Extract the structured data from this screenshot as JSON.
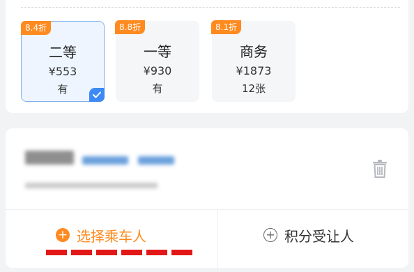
{
  "seat_options": [
    {
      "discount": "8.4折",
      "class_name": "二等",
      "price": "¥553",
      "availability": "有",
      "selected": true
    },
    {
      "discount": "8.8折",
      "class_name": "一等",
      "price": "¥930",
      "availability": "有",
      "selected": false
    },
    {
      "discount": "8.1折",
      "class_name": "商务",
      "price": "¥1873",
      "availability": "12张",
      "selected": false
    }
  ],
  "actions": {
    "select_passenger": "选择乘车人",
    "points_beneficiary": "积分受让人"
  },
  "icons": {
    "selected_check": "check-icon",
    "delete": "trash-icon",
    "add": "plus-circle-icon"
  },
  "colors": {
    "accent_orange": "#ff8a1f",
    "selected_blue": "#3d8af7",
    "selected_border": "#7fb2ee"
  }
}
